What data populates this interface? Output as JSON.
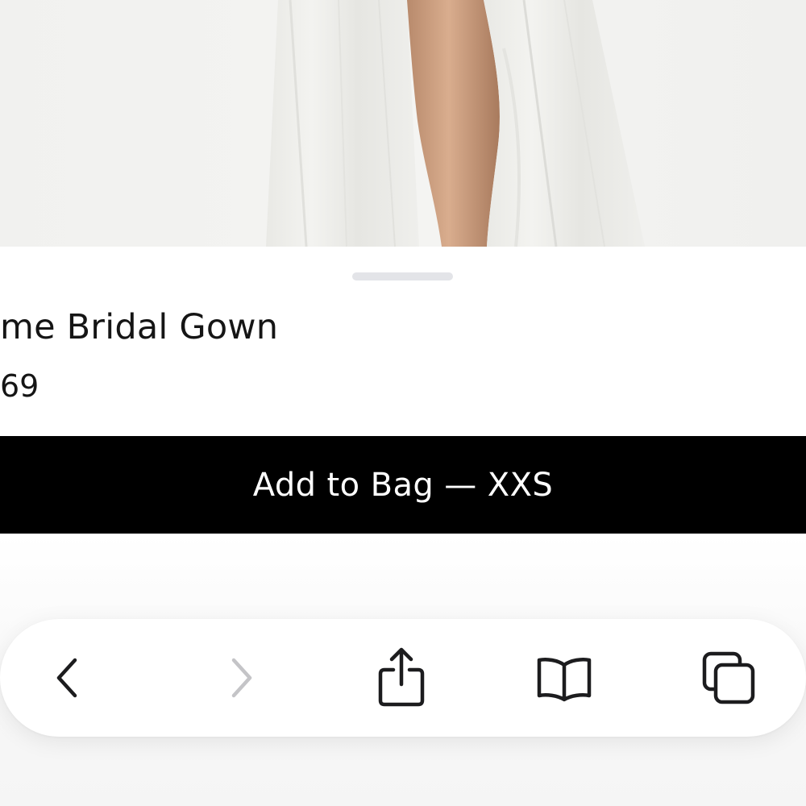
{
  "product": {
    "name": "me Bridal Gown",
    "price": "69"
  },
  "cta": {
    "add_to_bag_label": "Add to Bag — XXS"
  },
  "toolbar": {
    "icons": [
      "back-icon",
      "forward-icon",
      "share-icon",
      "bookmarks-icon",
      "tabs-icon"
    ],
    "forward_disabled": true
  },
  "colors": {
    "cta_background": "#000000",
    "cta_text": "#ffffff",
    "text_primary": "#151515",
    "icon_active": "#1c1c1e",
    "icon_disabled": "#c4c4c7",
    "grabber": "#e3e4e8"
  }
}
